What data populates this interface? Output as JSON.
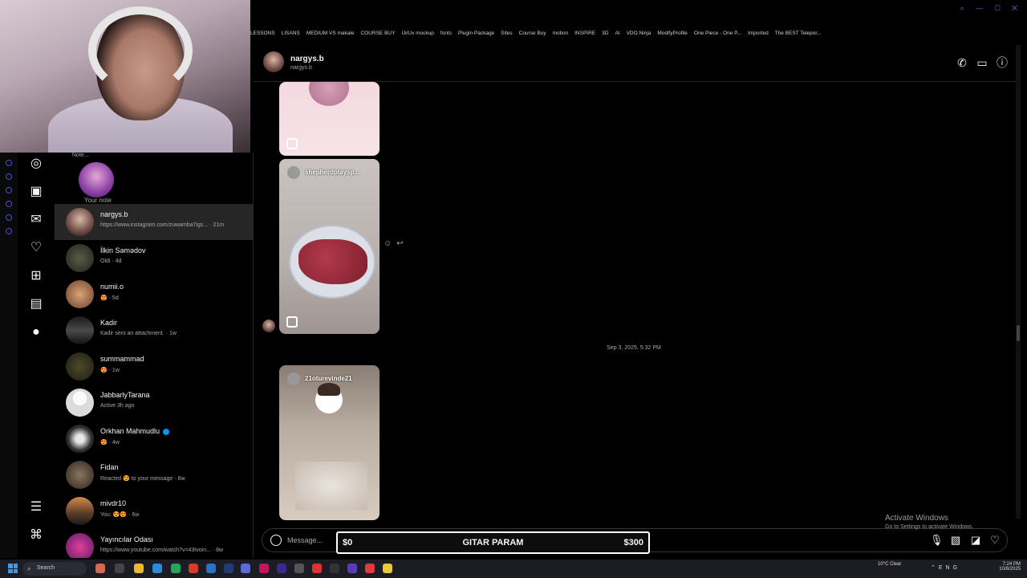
{
  "webcam": {
    "label": "webcam overlay"
  },
  "bookmarks": [
    "LESSONS",
    "LİSANS",
    "MEDIUM VS makale",
    "COURSE BUY",
    "Ui/Ux mockup",
    "fonts",
    "Plugin Package",
    "Sites",
    "Course Buy",
    "motion",
    "INSPIRE",
    "3D",
    "AI",
    "VDO.Ninja",
    "ModifyProfile",
    "One Piece - One P...",
    "Imported",
    "The BEST Telepor..."
  ],
  "note": {
    "bubble": "Note...",
    "label": "Your note"
  },
  "conversations": [
    {
      "name": "nargys.b",
      "sub": "https://www.instagram.com/zuwamba7igs... · 21m",
      "active": true
    },
    {
      "name": "İlkin Səmədov",
      "sub": "Oldi · 4d"
    },
    {
      "name": "numii.o",
      "sub": "😍 · 5d"
    },
    {
      "name": "Kadir",
      "sub": "Kadir sent an attachment. · 1w"
    },
    {
      "name": "summammad",
      "sub": "😍 · 1w"
    },
    {
      "name": "JabbarlyTarana",
      "sub": "Active 3h ago"
    },
    {
      "name": "Orkhan Mahmudlu",
      "sub": "😍 · 4w",
      "verified": true
    },
    {
      "name": "Fidan",
      "sub": "Reacted 😍 to your message · 6w"
    },
    {
      "name": "mivdr10",
      "sub": "You: 😍😍 · 6w"
    },
    {
      "name": "Yayıncılar Odası",
      "sub": "https://www.youtube.com/watch?v=43tvoin... · 8w"
    }
  ],
  "chat": {
    "name": "nargys.b",
    "username": "nargys.b",
    "posts": [
      {
        "title": ""
      },
      {
        "title": "shepherdplaysp..."
      },
      {
        "title": "21oturevinde21"
      }
    ],
    "timestamp": "Sep 3, 2025, 5:32 PM",
    "composer_placeholder": "Message..."
  },
  "overlay": {
    "low": "$0",
    "title": "GITAR PARAM",
    "high": "$300"
  },
  "activate": {
    "title": "Activate Windows",
    "subtitle": "Go to Settings to activate Windows."
  },
  "taskbar": {
    "search": "Search",
    "weather": "10°C\nClear",
    "lang": "ENG",
    "time": "7:24 PM",
    "date": "10/8/2025"
  },
  "colors": {
    "accent": "#0095f6",
    "bg": "#000000",
    "active_row": "#262626"
  }
}
